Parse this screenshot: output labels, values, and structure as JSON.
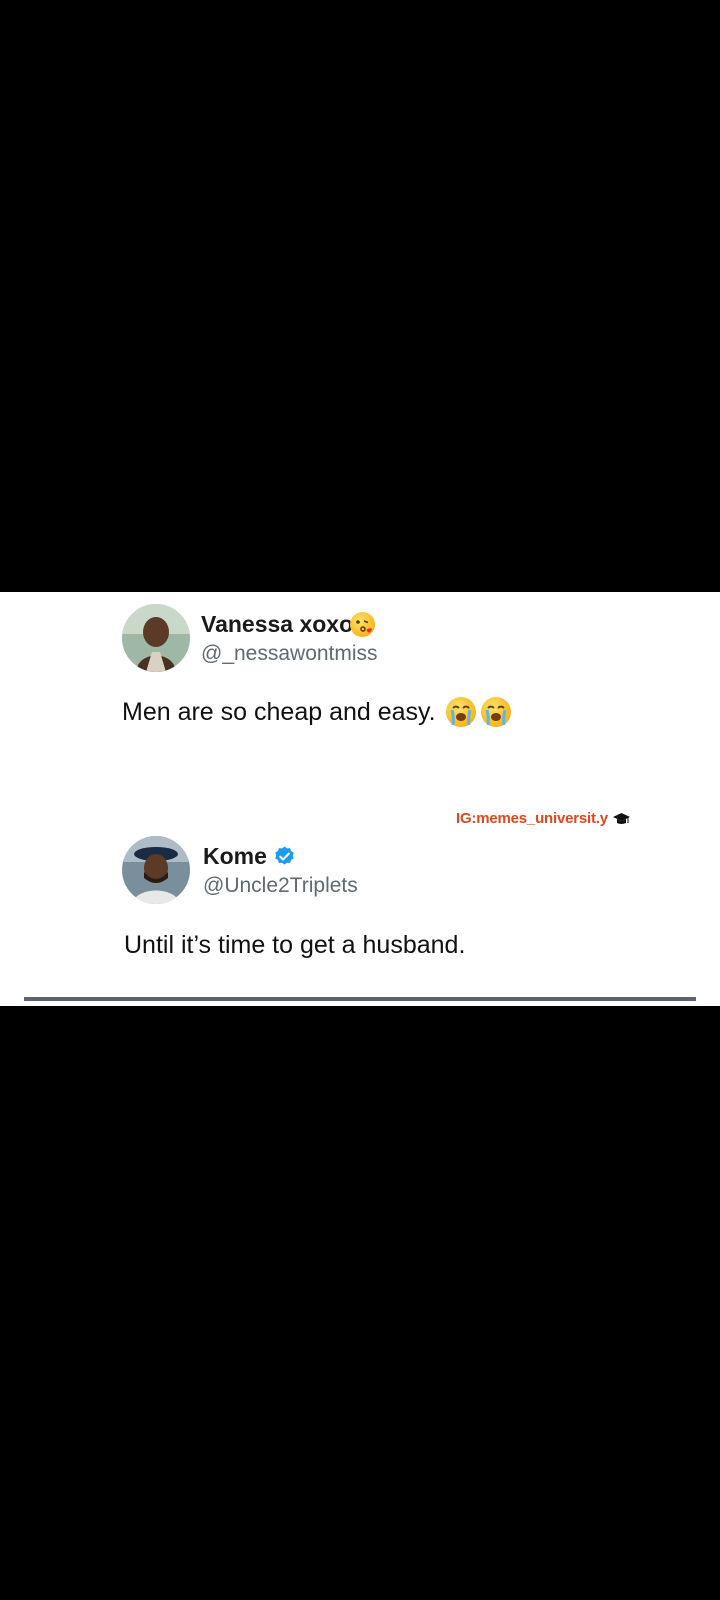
{
  "tweet1": {
    "name": "Vanessa xoxo",
    "name_emoji": "kissing-face-emoji",
    "handle": "@_nessawontmiss",
    "text": "Men are so cheap and easy.",
    "text_emojis": [
      "crying-face-emoji",
      "crying-face-emoji"
    ]
  },
  "watermark": {
    "text": "IG:memes_universit.y",
    "icon": "graduation-cap-icon",
    "color": "#e0471c"
  },
  "tweet2": {
    "name": "Kome",
    "verified": true,
    "verified_color": "#1d9bf0",
    "handle": "@Uncle2Triplets",
    "text": "Until it’s time to get a husband."
  }
}
